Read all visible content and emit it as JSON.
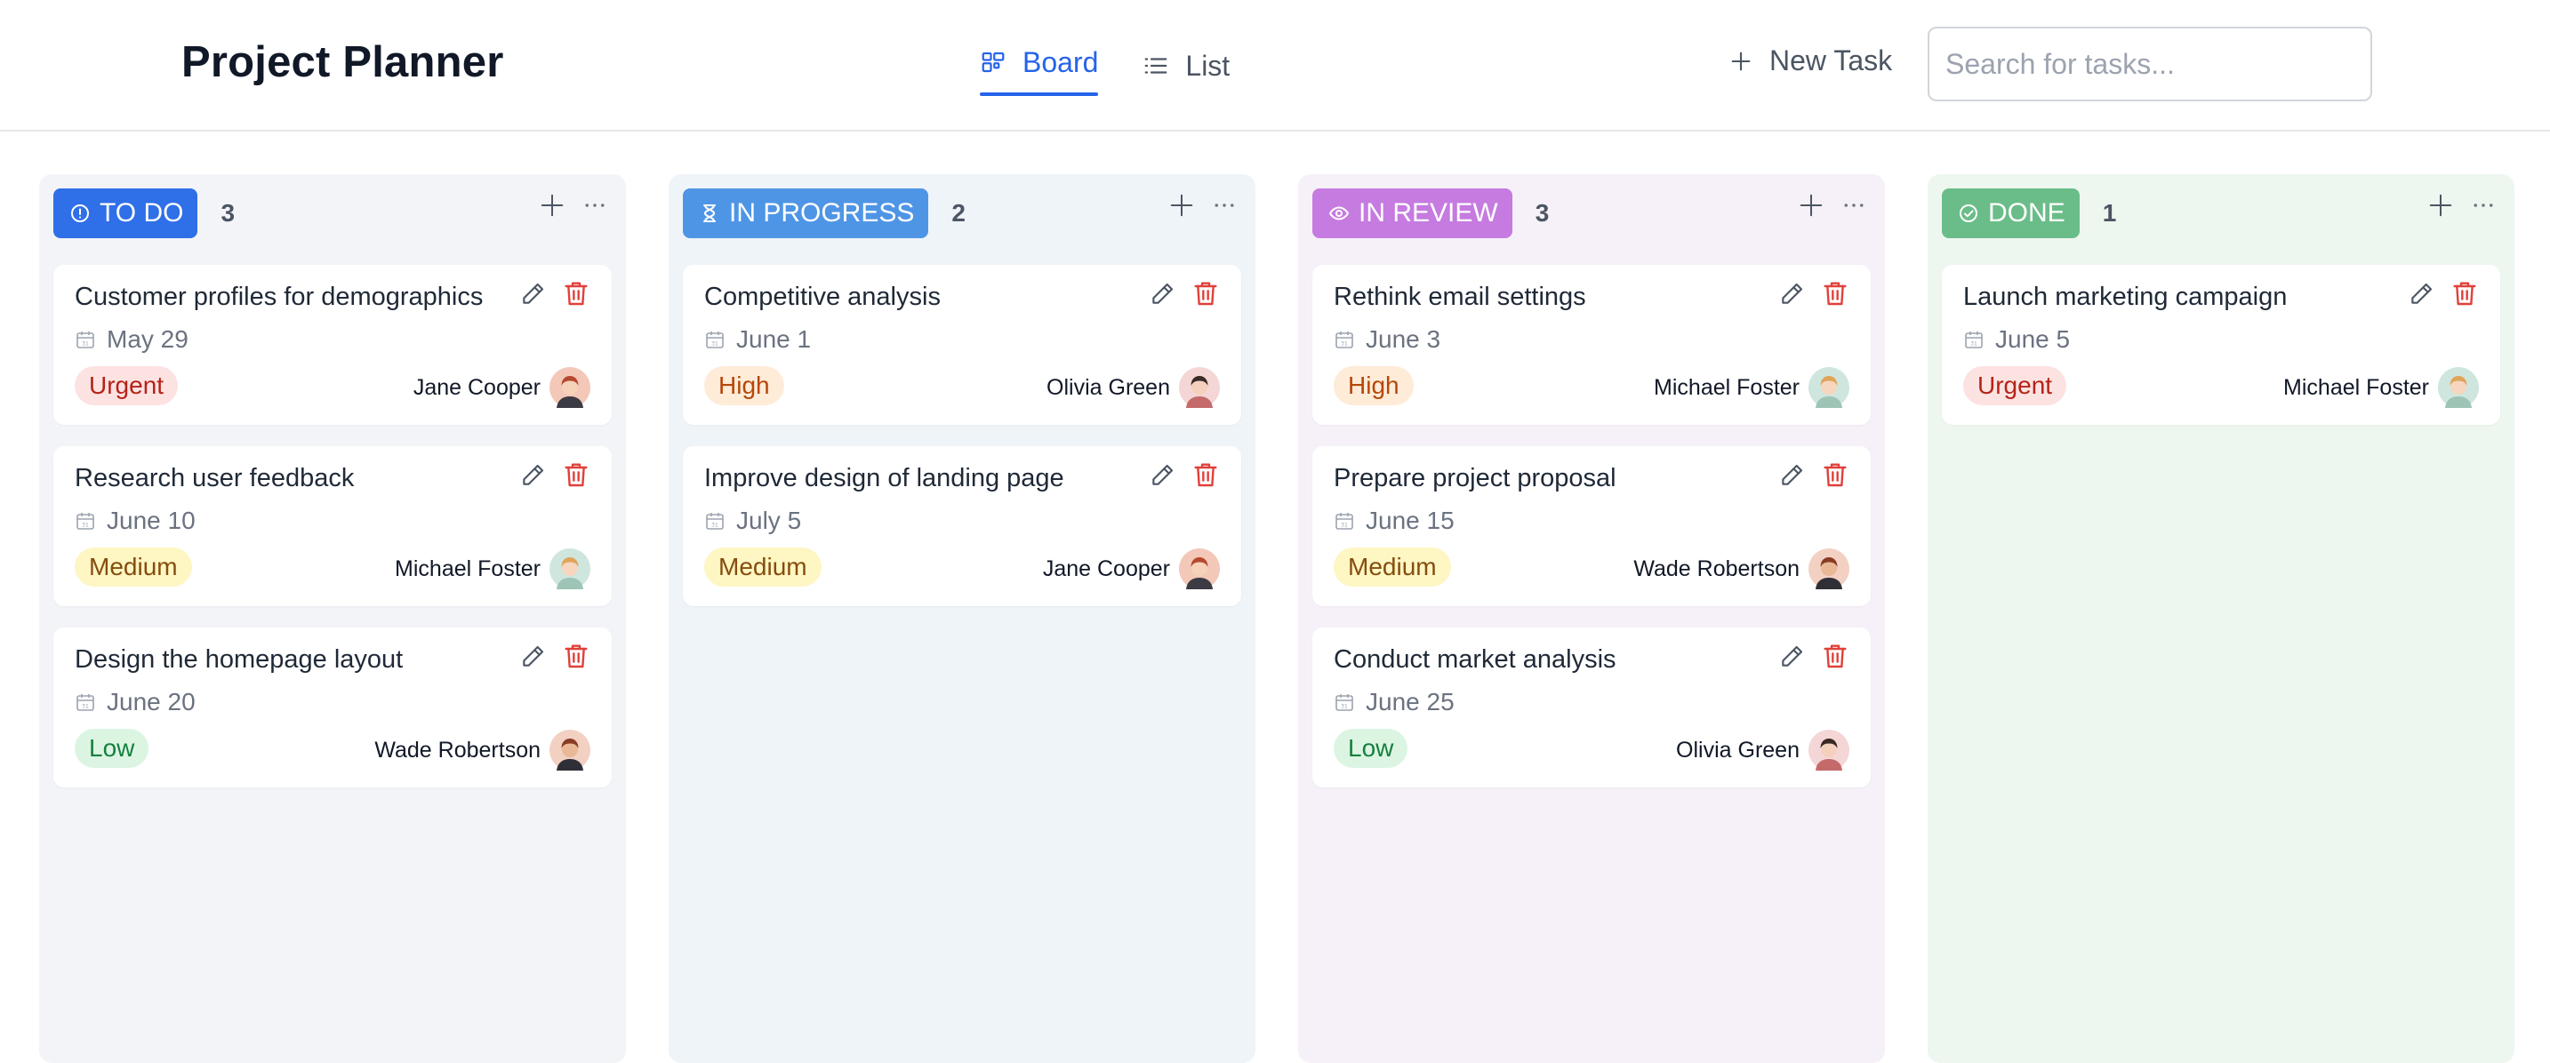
{
  "app": {
    "title": "Project Planner"
  },
  "tabs": [
    {
      "label": "Board",
      "icon": "board-icon",
      "active": true
    },
    {
      "label": "List",
      "icon": "list-icon",
      "active": false
    }
  ],
  "new_task_label": "New Task",
  "search": {
    "placeholder": "Search for tasks...",
    "value": ""
  },
  "colors": {
    "accent": "#2563eb",
    "urgent": "#b42318",
    "high": "#b54708",
    "medium": "#854d0e",
    "low": "#15803d"
  },
  "columns": [
    {
      "label": "TO DO",
      "count": "3",
      "icon": "info-circle-icon",
      "color": "#2f6fe8",
      "cards": [
        {
          "title": "Customer profiles for demographics",
          "date": "May 29",
          "priority": "Urgent",
          "assignee": "Jane Cooper",
          "avatar": "jane"
        },
        {
          "title": "Research user feedback",
          "date": "June 10",
          "priority": "Medium",
          "assignee": "Michael Foster",
          "avatar": "michael"
        },
        {
          "title": "Design the homepage layout",
          "date": "June 20",
          "priority": "Low",
          "assignee": "Wade Robertson",
          "avatar": "wade"
        }
      ]
    },
    {
      "label": "IN PROGRESS",
      "count": "2",
      "icon": "hourglass-icon",
      "color": "#4f95e6",
      "cards": [
        {
          "title": "Competitive analysis",
          "date": "June 1",
          "priority": "High",
          "assignee": "Olivia Green",
          "avatar": "olivia"
        },
        {
          "title": "Improve design of landing page",
          "date": "July 5",
          "priority": "Medium",
          "assignee": "Jane Cooper",
          "avatar": "jane"
        }
      ]
    },
    {
      "label": "IN REVIEW",
      "count": "3",
      "icon": "eye-icon",
      "color": "#c67be0",
      "cards": [
        {
          "title": "Rethink email settings",
          "date": "June 3",
          "priority": "High",
          "assignee": "Michael Foster",
          "avatar": "michael"
        },
        {
          "title": "Prepare project proposal",
          "date": "June 15",
          "priority": "Medium",
          "assignee": "Wade Robertson",
          "avatar": "wade"
        },
        {
          "title": "Conduct market analysis",
          "date": "June 25",
          "priority": "Low",
          "assignee": "Olivia Green",
          "avatar": "olivia"
        }
      ]
    },
    {
      "label": "DONE",
      "count": "1",
      "icon": "check-circle-icon",
      "color": "#6abd88",
      "cards": [
        {
          "title": "Launch marketing campaign",
          "date": "June 5",
          "priority": "Urgent",
          "assignee": "Michael Foster",
          "avatar": "michael"
        }
      ]
    }
  ]
}
